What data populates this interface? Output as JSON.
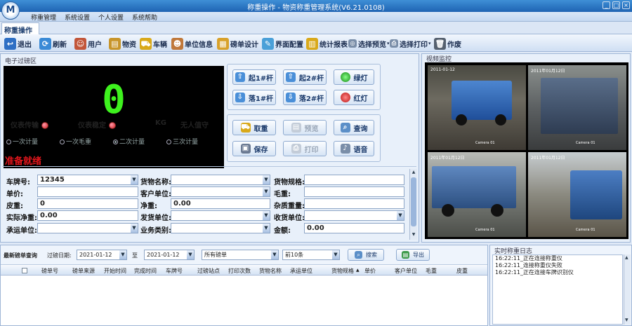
{
  "window": {
    "title": "称重操作 - 物资称重管理系统(V6.21.0108)",
    "logo_letter": "M"
  },
  "menu": [
    "称重管理",
    "系统设置",
    "个人设置",
    "系统帮助"
  ],
  "tab": {
    "label": "称重操作"
  },
  "toolbar": [
    {
      "label": "退出",
      "icon": "exit-icon",
      "color": "#2e6fc4"
    },
    {
      "label": "刷新",
      "icon": "refresh-icon",
      "color": "#3a8ad6"
    },
    {
      "label": "用户",
      "icon": "user-icon",
      "color": "#c2563a"
    },
    {
      "label": "物资",
      "icon": "goods-icon",
      "color": "#c8952a"
    },
    {
      "label": "车辆",
      "icon": "truck-icon",
      "color": "#d9a91a"
    },
    {
      "label": "单位信息",
      "icon": "company-icon",
      "color": "#c0783a"
    },
    {
      "label": "磅单设计",
      "icon": "design-icon",
      "color": "#d8a12a"
    },
    {
      "label": "界面配置",
      "icon": "config-icon",
      "color": "#4aa0d8"
    },
    {
      "label": "统计报表",
      "icon": "report-icon",
      "color": "#d9a91a"
    },
    {
      "label": "选择预览",
      "icon": "preview-icon",
      "color": "#7a8ea8"
    },
    {
      "label": "选择打印",
      "icon": "print-icon",
      "color": "#7a8ea8"
    },
    {
      "label": "作废",
      "icon": "trash-icon",
      "color": "#55606e"
    }
  ],
  "scale": {
    "section_title": "电子过磅区",
    "weight": "0",
    "status": {
      "meter_transmit": "仪表传输",
      "meter_stable": "仪表稳定",
      "unit": "KG",
      "unattended": "无人值守"
    },
    "count_modes": [
      "一次计量",
      "一次毛重",
      "二次计量",
      "三次计量"
    ],
    "ready": "准备就绪"
  },
  "controls": {
    "up1": "起1#杆",
    "up2": "起2#杆",
    "green": "绿灯",
    "down1": "落1#杆",
    "down2": "落2#杆",
    "red": "红灯",
    "weigh": "取重",
    "preview": "预览",
    "query": "查询",
    "save": "保存",
    "print": "打印",
    "voice": "语音"
  },
  "form": {
    "plate_label": "车牌号:",
    "plate_value": "12345",
    "goods_label": "货物名称:",
    "goods_value": "",
    "spec_label": "货物规格:",
    "spec_value": "",
    "price_label": "单价:",
    "price_value": "",
    "customer_label": "客户单位:",
    "customer_value": "",
    "gross_label": "毛重:",
    "gross_value": "",
    "tare_label": "皮重:",
    "tare_value": "0",
    "net_label": "净重:",
    "net_value": "0.00",
    "impurity_label": "杂质重量:",
    "impurity_value": "",
    "actual_net_label": "实际净重:",
    "actual_net_value": "0.00",
    "sender_label": "发货单位:",
    "sender_value": "",
    "receiver_label": "收货单位:",
    "receiver_value": "",
    "carrier_label": "承运单位:",
    "carrier_value": "",
    "business_label": "业务类别:",
    "business_value": "",
    "amount_label": "金额:",
    "amount_value": "0.00"
  },
  "video": {
    "title": "视频监控",
    "cameras": [
      {
        "stamp": "2011-01-12",
        "label": "Camera 01"
      },
      {
        "stamp": "2011年01月12日",
        "label": "Camera 01"
      },
      {
        "stamp": "2011年01月12日",
        "label": "Camera 01"
      },
      {
        "stamp": "2011年01月12日",
        "label": "Camera 01"
      }
    ]
  },
  "query": {
    "title": "最新磅单查询",
    "date_label": "过磅日期:",
    "date_from": "2021-01-12",
    "to_label": "至",
    "date_to": "2021-01-12",
    "filter": "所有磅单",
    "limit": "前10条",
    "search": "搜索",
    "export": "导出"
  },
  "grid": {
    "columns": [
      "磅单号",
      "磅单来源",
      "开始时间",
      "完成时间",
      "车牌号",
      "过磅站点",
      "打印次数",
      "货物名称",
      "承运单位",
      "货物规格",
      "单价",
      "客户单位",
      "毛重",
      "皮重"
    ]
  },
  "log": {
    "title": "实时称重日志",
    "lines": [
      "16:22:11_正在连接称重仪",
      "16:22:11_连接称重仪失败",
      "16:22:11_正在连接车牌识别仪"
    ]
  }
}
